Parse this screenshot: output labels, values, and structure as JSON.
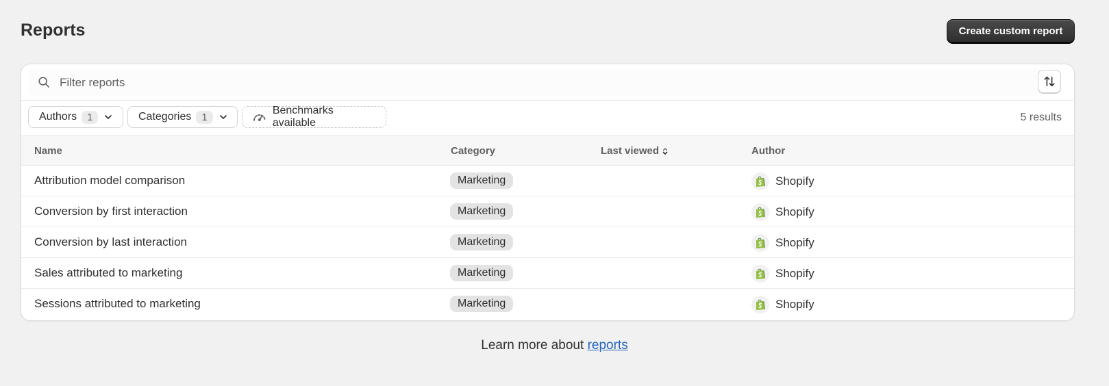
{
  "header": {
    "title": "Reports",
    "create_button": "Create custom report"
  },
  "search": {
    "placeholder": "Filter reports"
  },
  "filters": {
    "authors_label": "Authors",
    "authors_count": "1",
    "categories_label": "Categories",
    "categories_count": "1",
    "benchmarks_label": "Benchmarks available",
    "results": "5 results"
  },
  "table": {
    "columns": {
      "name": "Name",
      "category": "Category",
      "last_viewed": "Last viewed",
      "author": "Author"
    },
    "rows": [
      {
        "name": "Attribution model comparison",
        "category": "Marketing",
        "last_viewed": "",
        "author": "Shopify"
      },
      {
        "name": "Conversion by first interaction",
        "category": "Marketing",
        "last_viewed": "",
        "author": "Shopify"
      },
      {
        "name": "Conversion by last interaction",
        "category": "Marketing",
        "last_viewed": "",
        "author": "Shopify"
      },
      {
        "name": "Sales attributed to marketing",
        "category": "Marketing",
        "last_viewed": "",
        "author": "Shopify"
      },
      {
        "name": "Sessions attributed to marketing",
        "category": "Marketing",
        "last_viewed": "",
        "author": "Shopify"
      }
    ]
  },
  "footer": {
    "prefix": "Learn more about",
    "link": "reports"
  },
  "colors": {
    "primary_button": "#303030",
    "link": "#2463bc",
    "shopify_green": "#95bf47",
    "badge_bg": "#e3e3e3"
  },
  "icons": [
    "search-icon",
    "sort-icon",
    "chevron-down-icon",
    "gauge-icon",
    "sort-caret-icon",
    "shopify-logo-icon"
  ]
}
